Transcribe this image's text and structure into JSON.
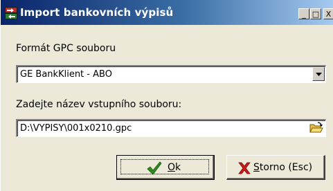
{
  "window": {
    "title": "Import bankovních výpisů",
    "minimize_glyph": "_",
    "maximize_glyph": "□",
    "close_glyph": "X"
  },
  "format": {
    "label": "Formát GPC souboru",
    "selected": "GE BankKlient - ABO"
  },
  "file": {
    "label": "Zadejte název vstupního souboru:",
    "value": "D:\\VYPISY\\001x0210.gpc"
  },
  "buttons": {
    "ok_mnemonic": "O",
    "ok_rest": "k",
    "cancel_mnemonic": "S",
    "cancel_rest": "torno (Esc)"
  },
  "colors": {
    "titlebar_start": "#0a246a",
    "titlebar_end": "#a6caf0",
    "window_bg": "#ece9d8",
    "ok_check": "#2e8b1f",
    "cancel_x": "#cc1a1a"
  },
  "icons": {
    "title": "app-icon",
    "combo": "dropdown-arrow-icon",
    "browse": "open-folder-icon",
    "ok": "checkmark-icon",
    "cancel": "red-x-icon"
  }
}
